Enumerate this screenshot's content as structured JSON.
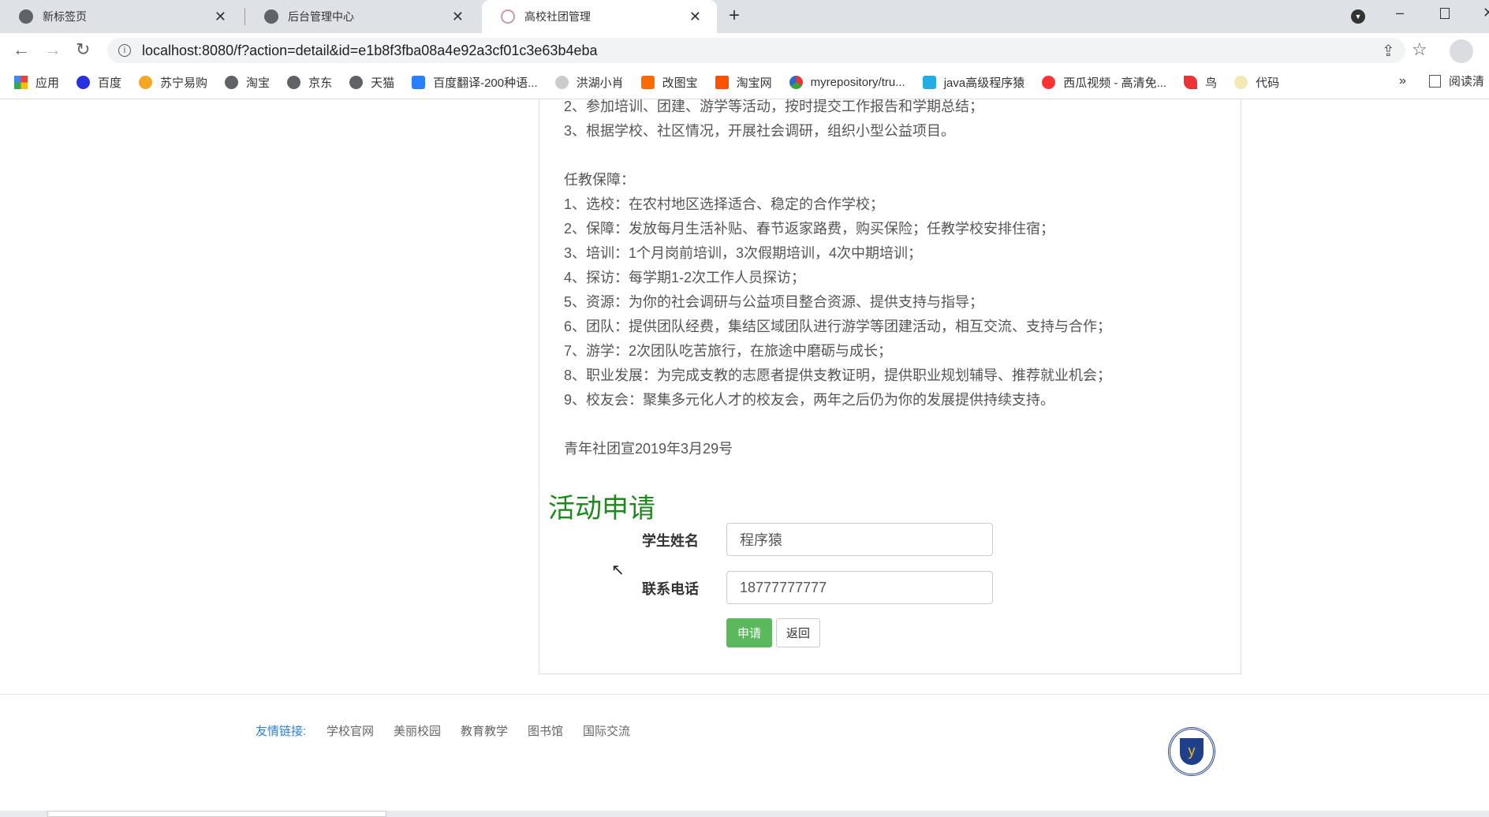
{
  "browser": {
    "tabs": [
      {
        "title": "新标签页"
      },
      {
        "title": "后台管理中心"
      },
      {
        "title": "高校社团管理"
      }
    ],
    "url": "localhost:8080/f?action=detail&id=e1b8f3fba08a4e92a3cf01c3e63b4eba",
    "bookmarks": [
      "应用",
      "百度",
      "苏宁易购",
      "淘宝",
      "京东",
      "天猫",
      "百度翻译-200种语...",
      "洪湖小肖",
      "改图宝",
      "淘宝网",
      "myrepository/tru...",
      "java高级程序猿",
      "西瓜视频 - 高清免...",
      "鸟",
      "代码"
    ],
    "more": "»",
    "reading_list": "阅读清"
  },
  "content": {
    "lines": [
      "2、参加培训、团建、游学等活动，按时提交工作报告和学期总结；",
      "3、根据学校、社区情况，开展社会调研，组织小型公益项目。",
      "",
      "任教保障：",
      "1、选校：在农村地区选择适合、稳定的合作学校；",
      "2、保障：发放每月生活补贴、春节返家路费，购买保险；任教学校安排住宿；",
      "3、培训：1个月岗前培训，3次假期培训，4次中期培训；",
      "4、探访：每学期1-2次工作人员探访；",
      "5、资源：为你的社会调研与公益项目整合资源、提供支持与指导；",
      "6、团队：提供团队经费，集结区域团队进行游学等团建活动，相互交流、支持与合作；",
      "7、游学：2次团队吃苦旅行，在旅途中磨砺与成长；",
      "8、职业发展：为完成支教的志愿者提供支教证明，提供职业规划辅导、推荐就业机会；",
      "9、校友会：聚集多元化人才的校友会，两年之后仍为你的发展提供持续支持。",
      "",
      "青年社团宣2019年3月29号"
    ]
  },
  "form": {
    "heading": "活动申请",
    "name_label": "学生姓名",
    "name_value": "程序猿",
    "phone_label": "联系电话",
    "phone_value": "18777777777",
    "submit": "申请",
    "back": "返回"
  },
  "footer": {
    "title": "友情链接:",
    "links": [
      "学校官网",
      "美丽校园",
      "教育教学",
      "图书馆",
      "国际交流"
    ]
  },
  "colors": {
    "accent": "#5cb85c",
    "heading": "#1e8a1e",
    "link": "#2a7fd4"
  }
}
